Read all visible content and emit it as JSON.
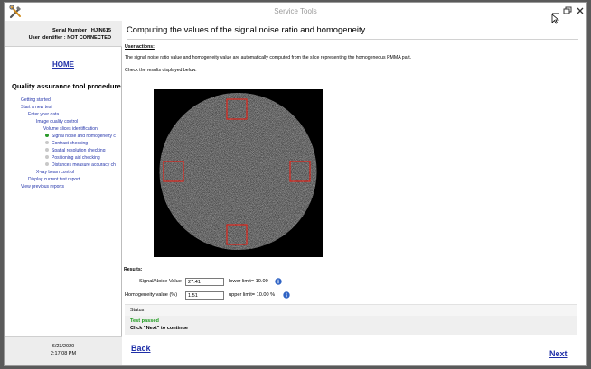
{
  "window": {
    "title": "Service Tools"
  },
  "sidebar": {
    "serial_number": "Serial Number : HJIN615",
    "user_identifier": "User Identifier : NOT CONNECTED",
    "home_label": "HOME",
    "procedure_title": "Quality assurance tool procedure",
    "tree": [
      {
        "label": "Getting started",
        "state": "none"
      },
      {
        "label": "Start a new test",
        "state": "none"
      },
      {
        "label": "Enter your data",
        "state": "none"
      },
      {
        "label": "Image quality control",
        "state": "none"
      },
      {
        "label": "Volume slices identification",
        "state": "none"
      },
      {
        "label": "Signal noise and homogeneity c",
        "state": "active"
      },
      {
        "label": "Contrast checking",
        "state": "pending"
      },
      {
        "label": "Spatial resolution checking",
        "state": "pending"
      },
      {
        "label": "Positioning aid checking",
        "state": "pending"
      },
      {
        "label": "Distances measure accuracy ch",
        "state": "pending"
      },
      {
        "label": "X-ray beam control",
        "state": "none"
      },
      {
        "label": "Display current test report",
        "state": "none"
      },
      {
        "label": "View previous reports",
        "state": "none"
      }
    ],
    "footer_date": "6/23/2020",
    "footer_time": "2:17:08 PM"
  },
  "main": {
    "title": "Computing the values of the signal noise ratio and homogeneity",
    "user_actions_label": "User actions:",
    "instruction_1": "The signal noise ratio value and homogeneity value are automatically computed from the slice representing the homogeneous PMMA part.",
    "instruction_2": "Check the results displayed below.",
    "results_label": "Results:",
    "snr_label": "Signal/Noise Value",
    "snr_value": "27.41",
    "snr_limit": "lower limit= 10.00",
    "homog_label": "Homogeneity value (%)",
    "homog_value": "1.51",
    "homog_limit": "upper limit= 10.00 %",
    "status_label": "Status",
    "status_passed": "Test passed",
    "status_next": "Click \"Next\" to continue",
    "back_label": "Back",
    "next_label": "Next"
  },
  "colors": {
    "link": "#1f2fa8",
    "roi": "#e0261c",
    "active_dot": "#2a9a2a",
    "pending_dot": "#c8c8c8",
    "pass_text": "#1b9a1b",
    "info_icon": "#2f63c4"
  }
}
